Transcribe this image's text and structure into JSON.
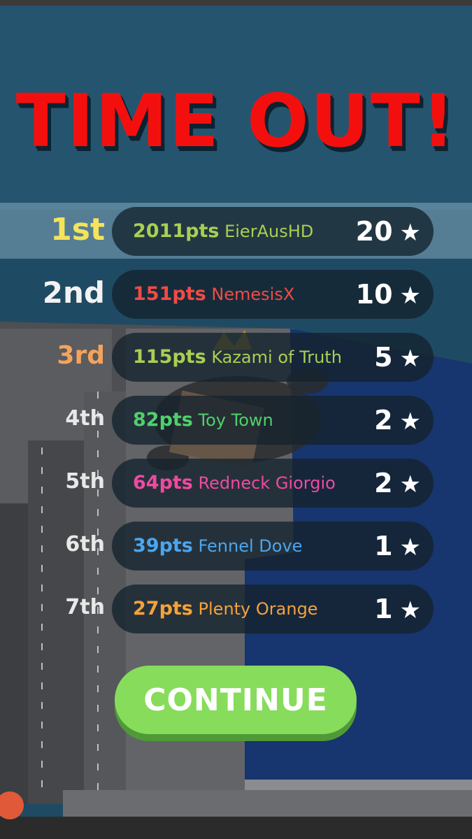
{
  "title": "TIME OUT!",
  "leaderboard": [
    {
      "rank": "1st",
      "points": "2011pts",
      "name": "EierAusHD",
      "stars": "20",
      "color": "#a9cf52",
      "rank_color": "#f5e35a"
    },
    {
      "rank": "2nd",
      "points": "151pts",
      "name": "NemesisX",
      "stars": "10",
      "color": "#f04b46",
      "rank_color": "#f2f2f2"
    },
    {
      "rank": "3rd",
      "points": "115pts",
      "name": "Kazami of Truth",
      "stars": "5",
      "color": "#a9cf52",
      "rank_color": "#f4a35c"
    },
    {
      "rank": "4th",
      "points": "82pts",
      "name": "Toy Town",
      "stars": "2",
      "color": "#4fd06c",
      "rank_color": "#e8e8e8"
    },
    {
      "rank": "5th",
      "points": "64pts",
      "name": "Redneck Giorgio",
      "stars": "2",
      "color": "#ef4aa2",
      "rank_color": "#e8e8e8"
    },
    {
      "rank": "6th",
      "points": "39pts",
      "name": "Fennel Dove",
      "stars": "1",
      "color": "#4aa6f0",
      "rank_color": "#e8e8e8"
    },
    {
      "rank": "7th",
      "points": "27pts",
      "name": "Plenty Orange",
      "stars": "1",
      "color": "#f3a23c",
      "rank_color": "#e8e8e8"
    }
  ],
  "continue_label": "CONTINUE",
  "colors": {
    "title": "#f40f0f",
    "continue": "#87dc5c",
    "highlight": "#96bed2"
  }
}
